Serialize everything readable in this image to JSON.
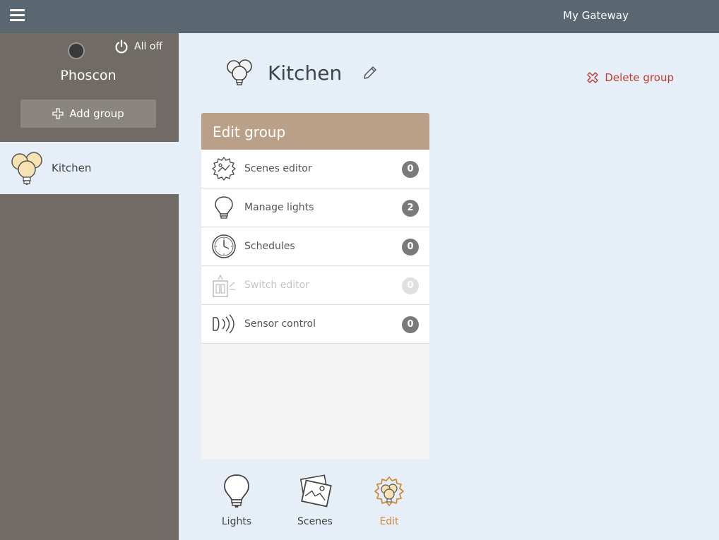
{
  "topbar": {
    "gateway_name": "My Gateway",
    "menu_icon": "hamburger-icon"
  },
  "sidebar": {
    "all_off_label": "All off",
    "brand": "Phoscon",
    "add_group_label": "Add group",
    "groups": [
      {
        "label": "Kitchen",
        "icon": "group-bulbs-icon",
        "selected": true
      }
    ]
  },
  "group": {
    "title": "Kitchen",
    "delete_label": "Delete group"
  },
  "panel": {
    "title": "Edit group",
    "items": [
      {
        "label": "Scenes editor",
        "count": "0",
        "icon": "scenes-gear-icon",
        "enabled": true
      },
      {
        "label": "Manage lights",
        "count": "2",
        "icon": "bulb-icon",
        "enabled": true
      },
      {
        "label": "Schedules",
        "count": "0",
        "icon": "clock-icon",
        "enabled": true
      },
      {
        "label": "Switch editor",
        "count": "0",
        "icon": "switch-icon",
        "enabled": false
      },
      {
        "label": "Sensor control",
        "count": "0",
        "icon": "sensor-icon",
        "enabled": true
      }
    ]
  },
  "tabs": [
    {
      "label": "Lights",
      "icon": "bulb-icon",
      "active": false
    },
    {
      "label": "Scenes",
      "icon": "scenes-pictures-icon",
      "active": false
    },
    {
      "label": "Edit",
      "icon": "edit-gear-icon",
      "active": true
    }
  ],
  "colors": {
    "topbar": "#5a6770",
    "sidebar": "#716b65",
    "panel_header": "#baa088",
    "delete": "#c0392b",
    "active_tab": "#d08a3c",
    "background": "#e6eef7"
  }
}
